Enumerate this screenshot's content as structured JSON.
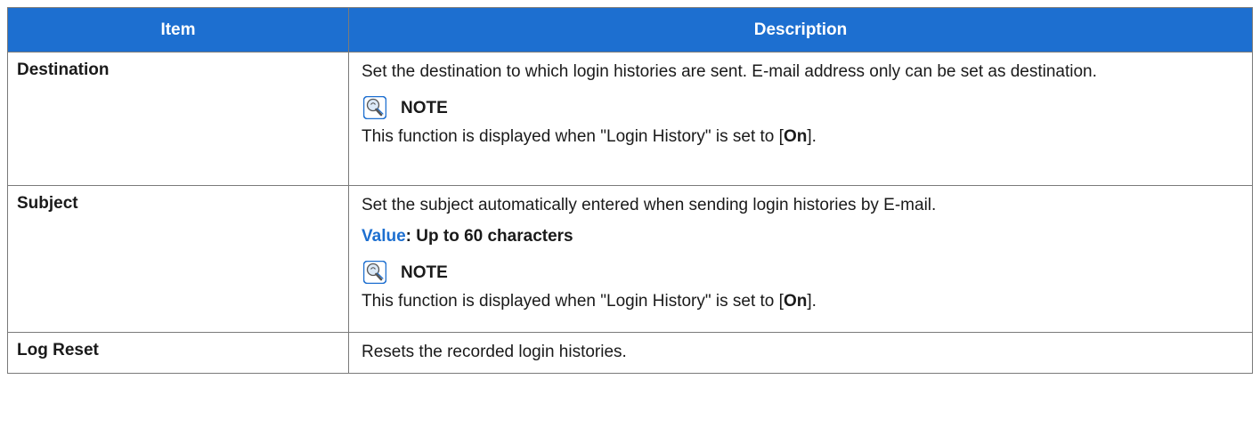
{
  "header": {
    "item": "Item",
    "description": "Description"
  },
  "rows": [
    {
      "item": "Destination",
      "desc": "Set the destination to which login histories are sent. E-mail address only can be set as destination.",
      "note_label": "NOTE",
      "note_pre": "This function is displayed when \"Login History\" is set to [",
      "note_bold": "On",
      "note_post": "]."
    },
    {
      "item": "Subject",
      "desc": "Set the subject automatically entered when sending login histories by E-mail.",
      "value_key": "Value",
      "value_text": ": Up to 60 characters",
      "note_label": "NOTE",
      "note_pre": "This function is displayed when \"Login History\" is set to [",
      "note_bold": "On",
      "note_post": "]."
    },
    {
      "item": "Log Reset",
      "desc": "Resets the recorded login histories."
    }
  ],
  "colors": {
    "header_bg": "#1d6fd0",
    "accent": "#1d6fd0"
  },
  "icons": {
    "note": "note-lightbulb-icon"
  }
}
